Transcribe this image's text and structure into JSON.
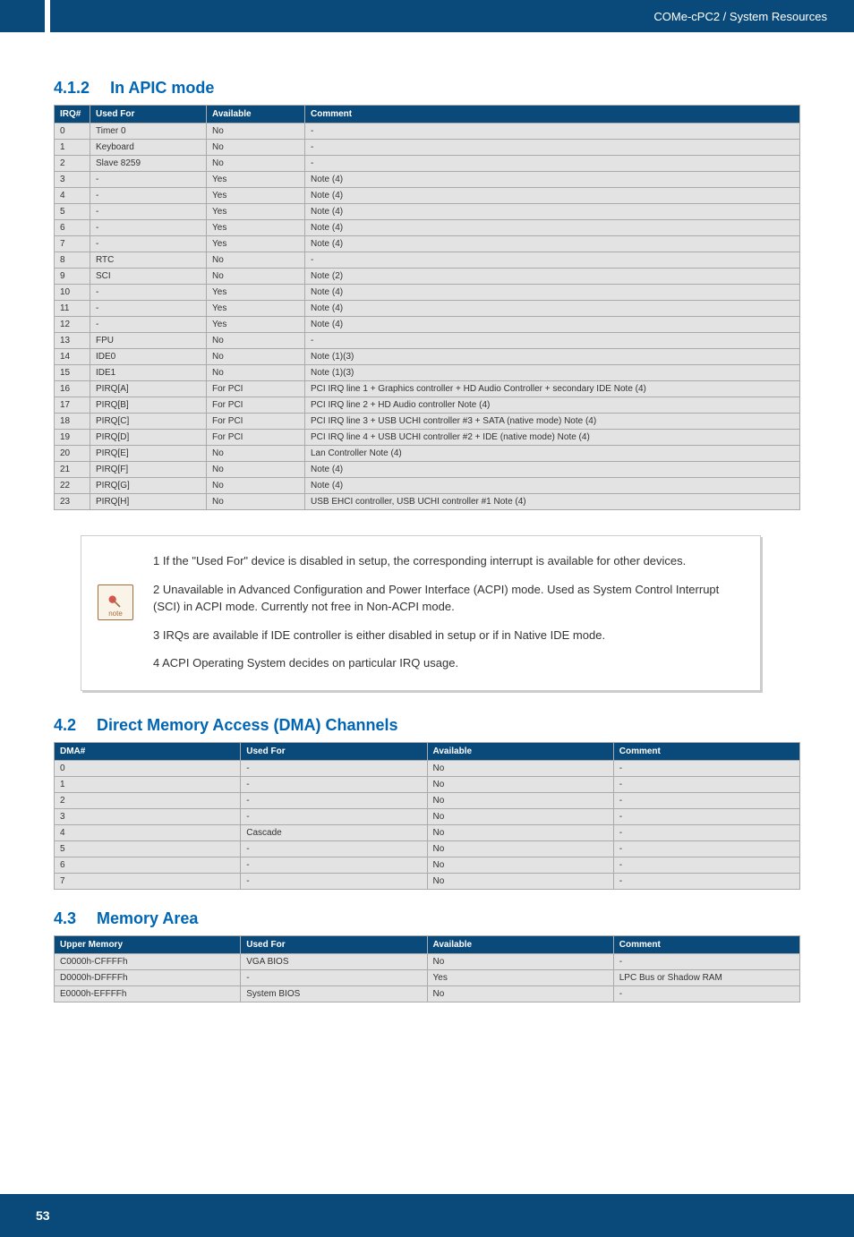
{
  "header": {
    "breadcrumb": "COMe-cPC2 / System Resources"
  },
  "section_apic": {
    "number": "4.1.2",
    "title": "In APIC mode",
    "columns": [
      "IRQ#",
      "Used For",
      "Available",
      "Comment"
    ],
    "rows": [
      [
        "0",
        "Timer 0",
        "No",
        "-"
      ],
      [
        "1",
        "Keyboard",
        "No",
        "-"
      ],
      [
        "2",
        "Slave 8259",
        "No",
        "-"
      ],
      [
        "3",
        "-",
        "Yes",
        "Note (4)"
      ],
      [
        "4",
        "-",
        "Yes",
        "Note (4)"
      ],
      [
        "5",
        "-",
        "Yes",
        "Note (4)"
      ],
      [
        "6",
        "-",
        "Yes",
        "Note (4)"
      ],
      [
        "7",
        "-",
        "Yes",
        "Note (4)"
      ],
      [
        "8",
        "RTC",
        "No",
        "-"
      ],
      [
        "9",
        "SCI",
        "No",
        "Note (2)"
      ],
      [
        "10",
        "-",
        "Yes",
        "Note (4)"
      ],
      [
        "11",
        "-",
        "Yes",
        "Note (4)"
      ],
      [
        "12",
        "-",
        "Yes",
        "Note (4)"
      ],
      [
        "13",
        "FPU",
        "No",
        "-"
      ],
      [
        "14",
        "IDE0",
        "No",
        "Note (1)(3)"
      ],
      [
        "15",
        "IDE1",
        "No",
        "Note (1)(3)"
      ],
      [
        "16",
        "PIRQ[A]",
        "For PCI",
        "PCI IRQ line 1 + Graphics controller + HD Audio Controller + secondary IDE Note (4)"
      ],
      [
        "17",
        "PIRQ[B]",
        "For PCI",
        "PCI IRQ line 2 + HD Audio controller Note (4)"
      ],
      [
        "18",
        "PIRQ[C]",
        "For PCI",
        "PCI IRQ line 3 + USB UCHI controller #3 + SATA (native mode) Note (4)"
      ],
      [
        "19",
        "PIRQ[D]",
        "For PCI",
        "PCI IRQ line 4 + USB UCHI controller #2 + IDE (native mode) Note (4)"
      ],
      [
        "20",
        "PIRQ[E]",
        "No",
        "Lan Controller Note (4)"
      ],
      [
        "21",
        "PIRQ[F]",
        "No",
        "Note (4)"
      ],
      [
        "22",
        "PIRQ[G]",
        "No",
        "Note (4)"
      ],
      [
        "23",
        "PIRQ[H]",
        "No",
        "USB EHCI controller, USB UCHI controller #1 Note (4)"
      ]
    ]
  },
  "note_box": {
    "icon_label": "note",
    "lines": [
      "1 If the \"Used For\" device is disabled in setup, the corresponding interrupt is available for other devices.",
      "2 Unavailable in Advanced Configuration and Power Interface (ACPI) mode. Used as System Control Interrupt (SCI) in ACPI mode. Currently not free in Non-ACPI mode.",
      "3 IRQs are available if IDE controller is either disabled in setup or if in Native IDE mode.",
      "4 ACPI Operating System decides on particular IRQ usage."
    ]
  },
  "section_dma": {
    "number": "4.2",
    "title": "Direct Memory Access (DMA) Channels",
    "columns": [
      "DMA#",
      "Used For",
      "Available",
      "Comment"
    ],
    "rows": [
      [
        "0",
        "-",
        "No",
        "-"
      ],
      [
        "1",
        "-",
        "No",
        "-"
      ],
      [
        "2",
        "-",
        "No",
        "-"
      ],
      [
        "3",
        "-",
        "No",
        "-"
      ],
      [
        "4",
        "Cascade",
        "No",
        "-"
      ],
      [
        "5",
        "-",
        "No",
        "-"
      ],
      [
        "6",
        "-",
        "No",
        "-"
      ],
      [
        "7",
        "-",
        "No",
        "-"
      ]
    ]
  },
  "section_mem": {
    "number": "4.3",
    "title": "Memory Area",
    "columns": [
      "Upper Memory",
      "Used For",
      "Available",
      "Comment"
    ],
    "rows": [
      [
        "C0000h-CFFFFh",
        "VGA BIOS",
        "No",
        "-"
      ],
      [
        "D0000h-DFFFFh",
        "-",
        "Yes",
        "LPC Bus or Shadow RAM"
      ],
      [
        "E0000h-EFFFFh",
        "System BIOS",
        "No",
        "-"
      ]
    ]
  },
  "footer": {
    "page": "53"
  }
}
